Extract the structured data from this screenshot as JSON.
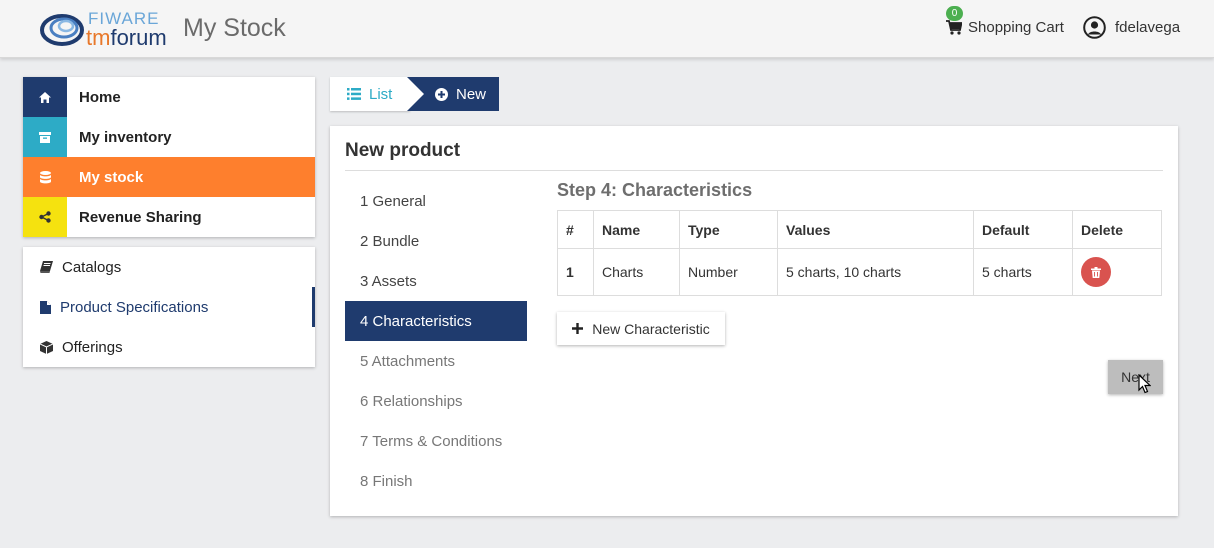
{
  "header": {
    "logo_top": "FIWARE",
    "logo_bottom_a": "tm",
    "logo_bottom_b": "forum",
    "app_title": "My Stock",
    "cart_count": "0",
    "cart_label": "Shopping Cart",
    "user_name": "fdelavega"
  },
  "sidebar": {
    "items": [
      {
        "label": "Home",
        "icon": "home-icon",
        "color": "#1f3b6e"
      },
      {
        "label": "My inventory",
        "icon": "archive-icon",
        "color": "#2dabc6"
      },
      {
        "label": "My stock",
        "icon": "database-icon",
        "color": "#fe7f2d"
      },
      {
        "label": "Revenue Sharing",
        "icon": "share-icon",
        "color": "#f5e20f"
      }
    ],
    "sub_items": [
      {
        "label": "Catalogs",
        "icon": "book-icon"
      },
      {
        "label": "Product Specifications",
        "icon": "file-icon"
      },
      {
        "label": "Offerings",
        "icon": "cube-icon"
      }
    ]
  },
  "breadcrumb": {
    "list_label": "List",
    "new_label": "New"
  },
  "panel": {
    "title": "New product",
    "steps": [
      "1 General",
      "2 Bundle",
      "3 Assets",
      "4 Characteristics",
      "5 Attachments",
      "6 Relationships",
      "7 Terms & Conditions",
      "8 Finish"
    ],
    "step_title": "Step 4: Characteristics",
    "table": {
      "headers": [
        "#",
        "Name",
        "Type",
        "Values",
        "Default",
        "Delete"
      ],
      "rows": [
        {
          "num": "1",
          "name": "Charts",
          "type": "Number",
          "values": "5 charts, 10 charts",
          "default": "5 charts"
        }
      ]
    },
    "new_char_label": "New Characteristic",
    "next_label": "Next"
  },
  "colors": {
    "primary": "#1f3b6e",
    "accent": "#fe7f2d",
    "info": "#2dabc6",
    "danger": "#d9534f"
  }
}
